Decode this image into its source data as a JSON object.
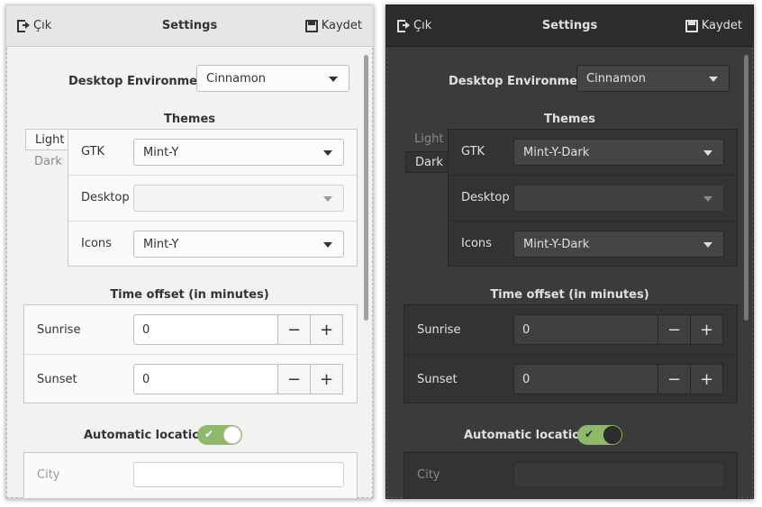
{
  "windows": [
    {
      "id": "light",
      "header": {
        "exit_label": "Çık",
        "title": "Settings",
        "save_label": "Kaydet"
      },
      "desktop_environment": {
        "label": "Desktop Environment",
        "value": "Cinnamon"
      },
      "themes": {
        "title": "Themes",
        "tabs": [
          {
            "label": "Light",
            "active": true
          },
          {
            "label": "Dark",
            "active": false
          }
        ],
        "rows": [
          {
            "label": "GTK",
            "value": "Mint-Y",
            "enabled": true
          },
          {
            "label": "Desktop",
            "value": "",
            "enabled": false
          },
          {
            "label": "Icons",
            "value": "Mint-Y",
            "enabled": true
          }
        ]
      },
      "time_offset": {
        "title": "Time offset (in minutes)",
        "rows": [
          {
            "label": "Sunrise",
            "value": "0"
          },
          {
            "label": "Sunset",
            "value": "0"
          }
        ],
        "minus": "−",
        "plus": "+"
      },
      "automatic_location": {
        "label": "Automatic location",
        "enabled": true,
        "check": "✔"
      },
      "city": {
        "label": "City",
        "value": ""
      }
    },
    {
      "id": "dark",
      "header": {
        "exit_label": "Çık",
        "title": "Settings",
        "save_label": "Kaydet"
      },
      "desktop_environment": {
        "label": "Desktop Environment",
        "value": "Cinnamon"
      },
      "themes": {
        "title": "Themes",
        "tabs": [
          {
            "label": "Light",
            "active": false
          },
          {
            "label": "Dark",
            "active": true
          }
        ],
        "rows": [
          {
            "label": "GTK",
            "value": "Mint-Y-Dark",
            "enabled": true
          },
          {
            "label": "Desktop",
            "value": "",
            "enabled": false
          },
          {
            "label": "Icons",
            "value": "Mint-Y-Dark",
            "enabled": true
          }
        ]
      },
      "time_offset": {
        "title": "Time offset (in minutes)",
        "rows": [
          {
            "label": "Sunrise",
            "value": "0"
          },
          {
            "label": "Sunset",
            "value": "0"
          }
        ],
        "minus": "−",
        "plus": "+"
      },
      "automatic_location": {
        "label": "Automatic location",
        "enabled": true,
        "check": "✔"
      },
      "city": {
        "label": "City",
        "value": ""
      }
    }
  ],
  "colors": {
    "toggle_on": "#8fb86a",
    "light_bg": "#f2f2f2",
    "dark_bg": "#3b3b3b"
  }
}
